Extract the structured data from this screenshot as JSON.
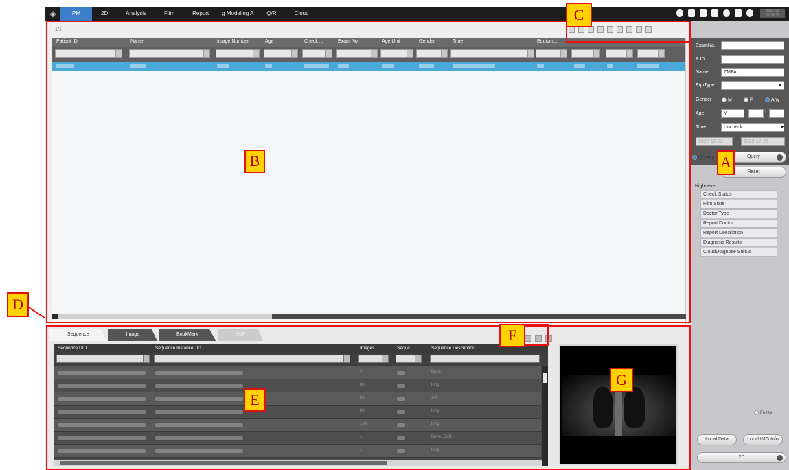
{
  "menu": {
    "items": [
      "PM",
      "2D",
      "Analysis",
      "Film",
      "Report",
      "g Modeling A",
      "Q/R",
      "Cloud"
    ],
    "active_index": 0
  },
  "top_right_text": "2022-12\n09:31:41",
  "list": {
    "page_indicator": "1/1",
    "columns": [
      "Patient ID",
      "Name",
      "Image Number",
      "Age",
      "Check ...",
      "Exam No.",
      "Age Unit",
      "Gender",
      "Time",
      "Equipm...",
      "",
      "",
      "",
      ""
    ]
  },
  "search": {
    "examno_label": "ExamNo.",
    "pid_label": "P ID",
    "name_label": "Name",
    "name_value": "ZMFA",
    "equtype_label": "EquType",
    "gender_label": "Gender",
    "gender_options": [
      "M",
      "F",
      "Any"
    ],
    "gender_selected": "Any",
    "age_label": "Age",
    "age_unit": "Y",
    "age_sep": "-",
    "time_label": "Time",
    "time_value": "Uncheck",
    "date_from": "2022-12-22",
    "date_to": "2022-12-22",
    "qquery_label": "QQuery",
    "query_label": "Query",
    "reset_label": "Reset",
    "highlevel_title": "High-level",
    "highlevel_items": [
      "Check Status",
      "Film State",
      "Doctor Type",
      "Report Doctor",
      "Report Description",
      "Diagnosis Results",
      "CloudDiagnose Status"
    ],
    "fuzzy_label": "Fuzzy",
    "local_data_label": "Local Data",
    "local_img_label": "Local IMG Info",
    "mode_label": "2D"
  },
  "bottom": {
    "tabs": [
      "Sequence",
      "Image",
      "BookMark",
      "SOP"
    ],
    "seq_columns": [
      "Sequence UID",
      "Sequence InstanceUID",
      "Images",
      "Seque...",
      "Sequence Description"
    ],
    "rows": [
      {
        "count": "3",
        "desc": "Bone"
      },
      {
        "count": "88",
        "desc": "lung"
      },
      {
        "count": "88",
        "desc": "soft"
      },
      {
        "count": "88",
        "desc": "lung"
      },
      {
        "count": "109",
        "desc": "lung"
      },
      {
        "count": "1",
        "desc": "Bone, CXR"
      },
      {
        "count": "1",
        "desc": "lung"
      }
    ]
  },
  "annotations": {
    "A": "A",
    "B": "B",
    "C": "C",
    "D": "D",
    "E": "E",
    "F": "F",
    "G": "G"
  },
  "colors": {
    "accent": "#3c7fc8",
    "selection": "#4ba9d8",
    "annotation_border": "#e11111",
    "annotation_fill": "#ffd200"
  }
}
